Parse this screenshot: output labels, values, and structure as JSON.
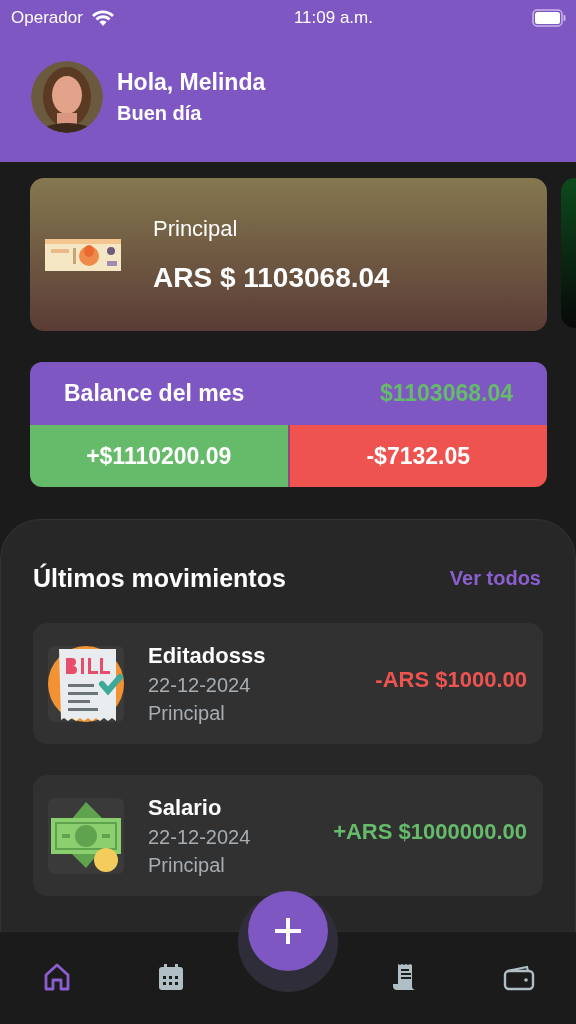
{
  "status_bar": {
    "carrier": "Operador",
    "time": "11:09 a.m."
  },
  "header": {
    "greeting": "Hola, Melinda",
    "subtitle": "Buen día"
  },
  "accounts": [
    {
      "name": "Principal",
      "balance": "ARS $ 1103068.04",
      "color": "#85784f"
    },
    {
      "color": "#0d4a1c"
    }
  ],
  "balance": {
    "title": "Balance del mes",
    "total": "$1103068.04",
    "income": "+$1110200.09",
    "expense": "-$7132.05"
  },
  "movements_section": {
    "title": "Últimos movimientos",
    "link": "Ver todos"
  },
  "movements": [
    {
      "kind": "expense",
      "name": "Editadosss",
      "date": "22-12-2024",
      "account": "Principal",
      "amount": "-ARS $1000.00"
    },
    {
      "kind": "income",
      "name": "Salario",
      "date": "22-12-2024",
      "account": "Principal",
      "amount": "+ARS $1000000.00"
    }
  ],
  "nav": [
    {
      "selected": true
    },
    {
      "selected": false
    },
    {
      "selected": false
    },
    {
      "selected": false
    }
  ]
}
